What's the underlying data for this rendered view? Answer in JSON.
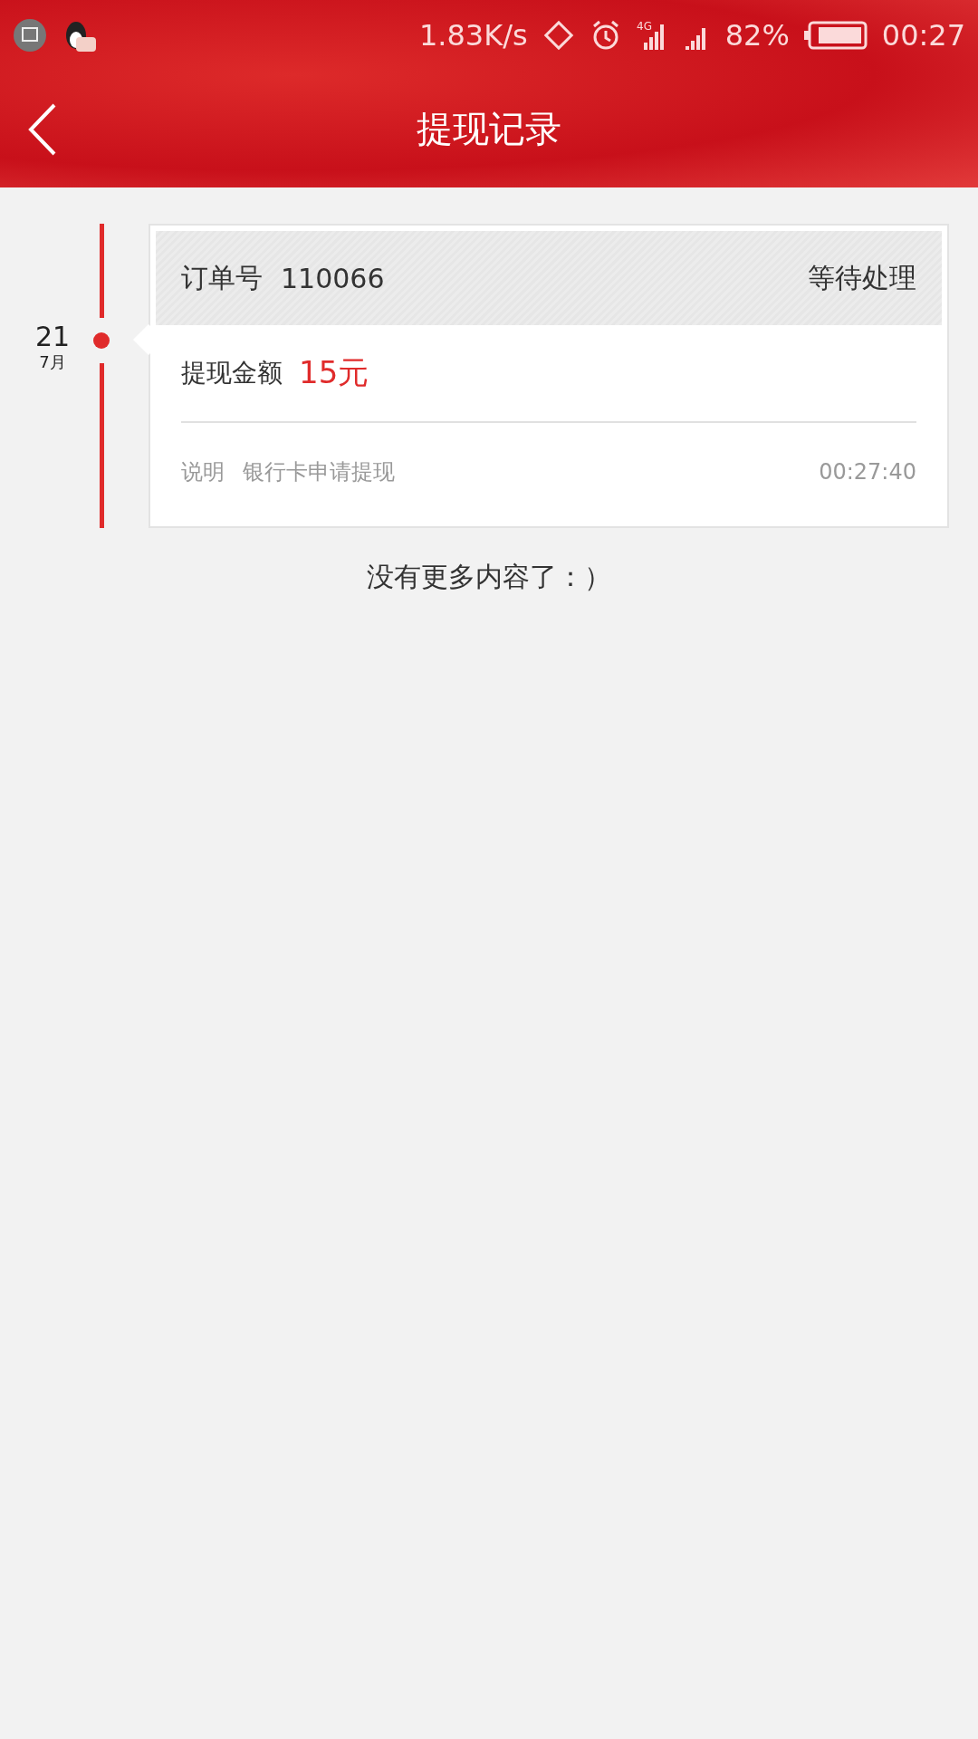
{
  "status_bar": {
    "speed": "1.83K/s",
    "battery": "82%",
    "time": "00:27",
    "network": "4G"
  },
  "header": {
    "title": "提现记录"
  },
  "records": [
    {
      "day": "21",
      "month": "7月",
      "order_label": "订单号",
      "order_no": "110066",
      "status": "等待处理",
      "amount_label": "提现金额",
      "amount": "15元",
      "note_label": "说明",
      "note": "银行卡申请提现",
      "time": "00:27:40"
    }
  ],
  "footer": "没有更多内容了：）"
}
